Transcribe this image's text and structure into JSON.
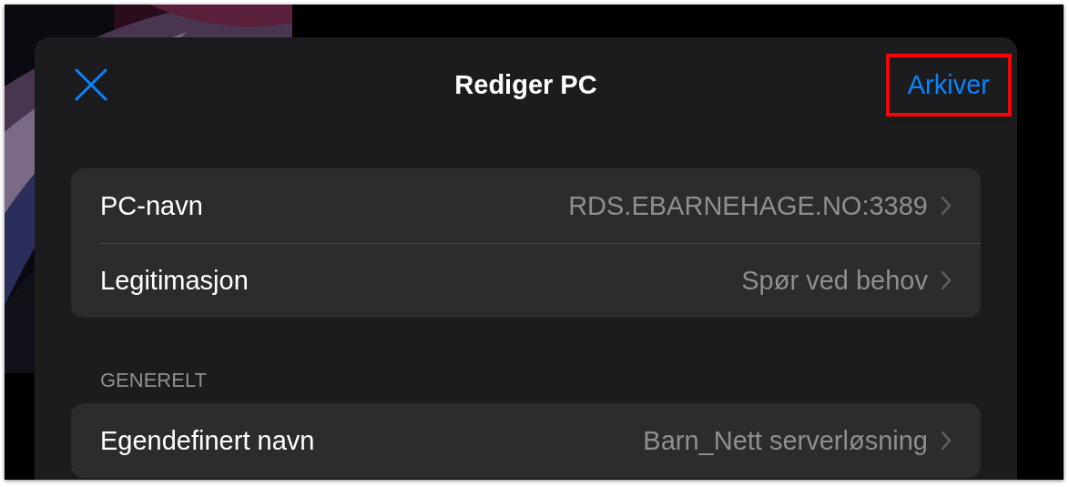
{
  "header": {
    "title": "Rediger PC",
    "action": {
      "label": "Arkiver",
      "highlighted": true
    }
  },
  "groups": [
    {
      "rows": [
        {
          "label": "PC-navn",
          "value": "RDS.EBARNEHAGE.NO:3389"
        },
        {
          "label": "Legitimasjon",
          "value": "Spør ved behov"
        }
      ]
    },
    {
      "heading": "GENERELT",
      "rows": [
        {
          "label": "Egendefinert navn",
          "value": "Barn_Nett serverløsning"
        }
      ]
    }
  ]
}
